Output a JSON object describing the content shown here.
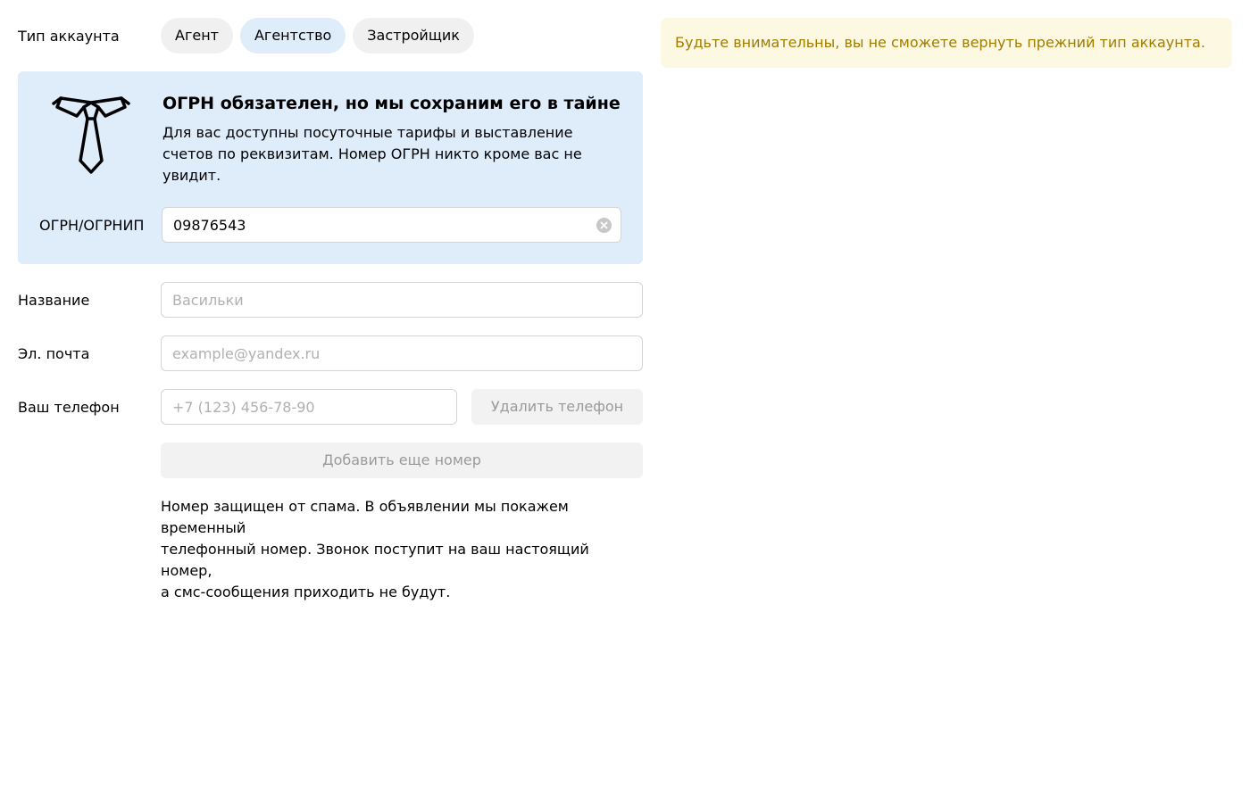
{
  "account_type": {
    "label": "Тип аккаунта",
    "options": [
      "Агент",
      "Агентство",
      "Застройщик"
    ],
    "selected": "Агентство"
  },
  "ogrn_box": {
    "icon": "tie-icon",
    "title": "ОГРН обязателен, но мы сохраним его в тайне",
    "description": "Для вас доступны посуточные тарифы и выставление счетов по реквизитам. Номер ОГРН никто кроме вас не увидит.",
    "field_label": "ОГРН/ОГРНИП",
    "field_value": "09876543"
  },
  "name_field": {
    "label": "Название",
    "placeholder": "Васильки"
  },
  "email_field": {
    "label": "Эл. почта",
    "placeholder": "example@yandex.ru"
  },
  "phone_field": {
    "label": "Ваш телефон",
    "placeholder": "+7 (123) 456-78-90",
    "delete_label": "Удалить телефон",
    "add_label": "Добавить еще номер"
  },
  "note_lines": [
    "Номер защищен от спама. В объявлении мы покажем временный",
    "телефонный номер. Звонок поступит на ваш настоящий номер,",
    "а смс-сообщения приходить не будут."
  ],
  "warning": "Будьте внимательны, вы не сможете вернуть прежний тип аккаунта.",
  "colors": {
    "selected_pill": "#dfecfa",
    "warning_bg": "#fdf8e1",
    "warning_text": "#a07c00"
  }
}
